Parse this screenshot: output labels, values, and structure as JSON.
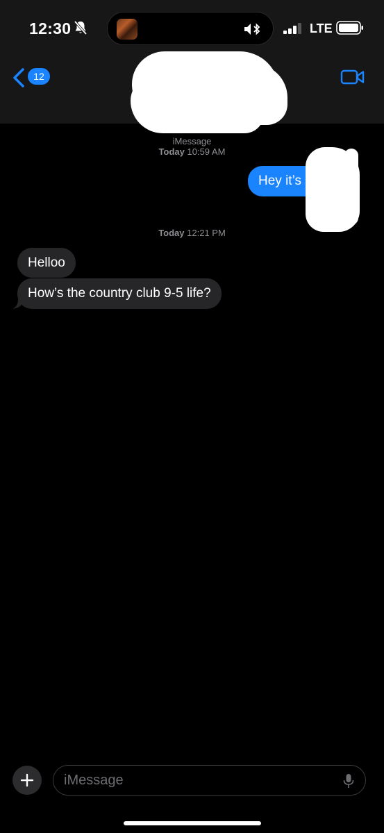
{
  "status_bar": {
    "time": "12:30",
    "network": "LTE"
  },
  "nav": {
    "unread_count": "12"
  },
  "thread": {
    "service_label": "iMessage",
    "first_timestamp": {
      "day": "Today",
      "time": "10:59 AM"
    },
    "second_timestamp": {
      "day": "Today",
      "time": "12:21 PM"
    },
    "messages": [
      {
        "direction": "sent",
        "text": "Hey it’s"
      },
      {
        "direction": "received",
        "text": "Helloo"
      },
      {
        "direction": "received",
        "text": "How’s the country club 9-5 life?"
      }
    ]
  },
  "composer": {
    "placeholder": "iMessage"
  },
  "colors": {
    "accent": "#1a84ff",
    "received_bubble": "#262628",
    "header_bg": "#171717"
  }
}
